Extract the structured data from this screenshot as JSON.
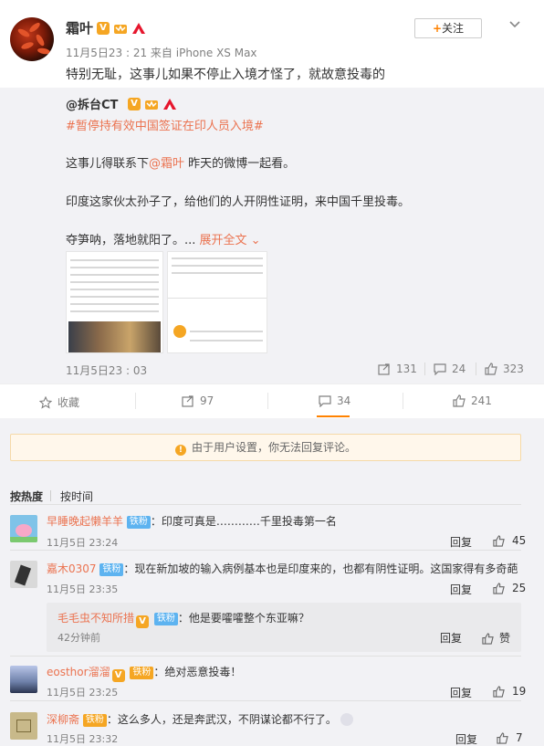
{
  "post": {
    "username": "霜叶",
    "meta": "11月5日23 : 21 来自 iPhone XS Max",
    "text": "特别无耻，这事儿如果不停止入境才怪了，就故意投毒的",
    "follow_label": "关注"
  },
  "repost": {
    "user": "@拆台CT",
    "tag": "#暂停持有效中国签证在印人员入境#",
    "line1_prefix": "这事儿得联系下",
    "line1_mention": "@霜叶",
    "line1_suffix": " 昨天的微博一起看。",
    "line2": "印度这家伙太孙子了，给他们的人开阴性证明，来中国千里投毒。",
    "line3": "夺笋呐，落地就阳了。... ",
    "expand": "展开全文",
    "time": "11月5日23 : 03",
    "forwards": "131",
    "comments": "24",
    "likes": "323"
  },
  "actions": {
    "favorite": "收藏",
    "forward": "97",
    "comment": "34",
    "like": "241"
  },
  "notice": "由于用户设置，你无法回复评论。",
  "sort": {
    "hot": "按热度",
    "time": "按时间"
  },
  "comments": [
    {
      "name": "早睡晚起懒羊羊",
      "fan": "铁粉",
      "text": "：印度可真是…………千里投毒第一名",
      "time": "11月5日 23:24",
      "reply": "回复",
      "likes": "45"
    },
    {
      "name": "嘉木0307",
      "fan": "铁粉",
      "text": "：现在新加坡的输入病例基本也是印度来的，也都有阴性证明。这国家得有多奇葩",
      "time": "11月5日 23:35",
      "reply": "回复",
      "likes": "25"
    },
    {
      "name": "毛毛虫不知所措",
      "fan": "铁粉",
      "text": "：他是要嚯嚯整个东亚嘛？",
      "time": "42分钟前",
      "reply": "回复",
      "likes": "赞"
    },
    {
      "name": "eosthor溜溜",
      "fan": "铁粉",
      "text": "：绝对恶意投毒！",
      "time": "11月5日 23:25",
      "reply": "回复",
      "likes": "19"
    },
    {
      "name": "深柳斋",
      "fan": "铁粉",
      "text": "：这么多人，还是奔武汉，不阴谋论都不行了。",
      "time": "11月5日 23:32",
      "reply": "回复",
      "likes": "7"
    }
  ],
  "colors": {
    "accent": "#ff8200",
    "link": "#eb7350",
    "muted": "#808080"
  }
}
